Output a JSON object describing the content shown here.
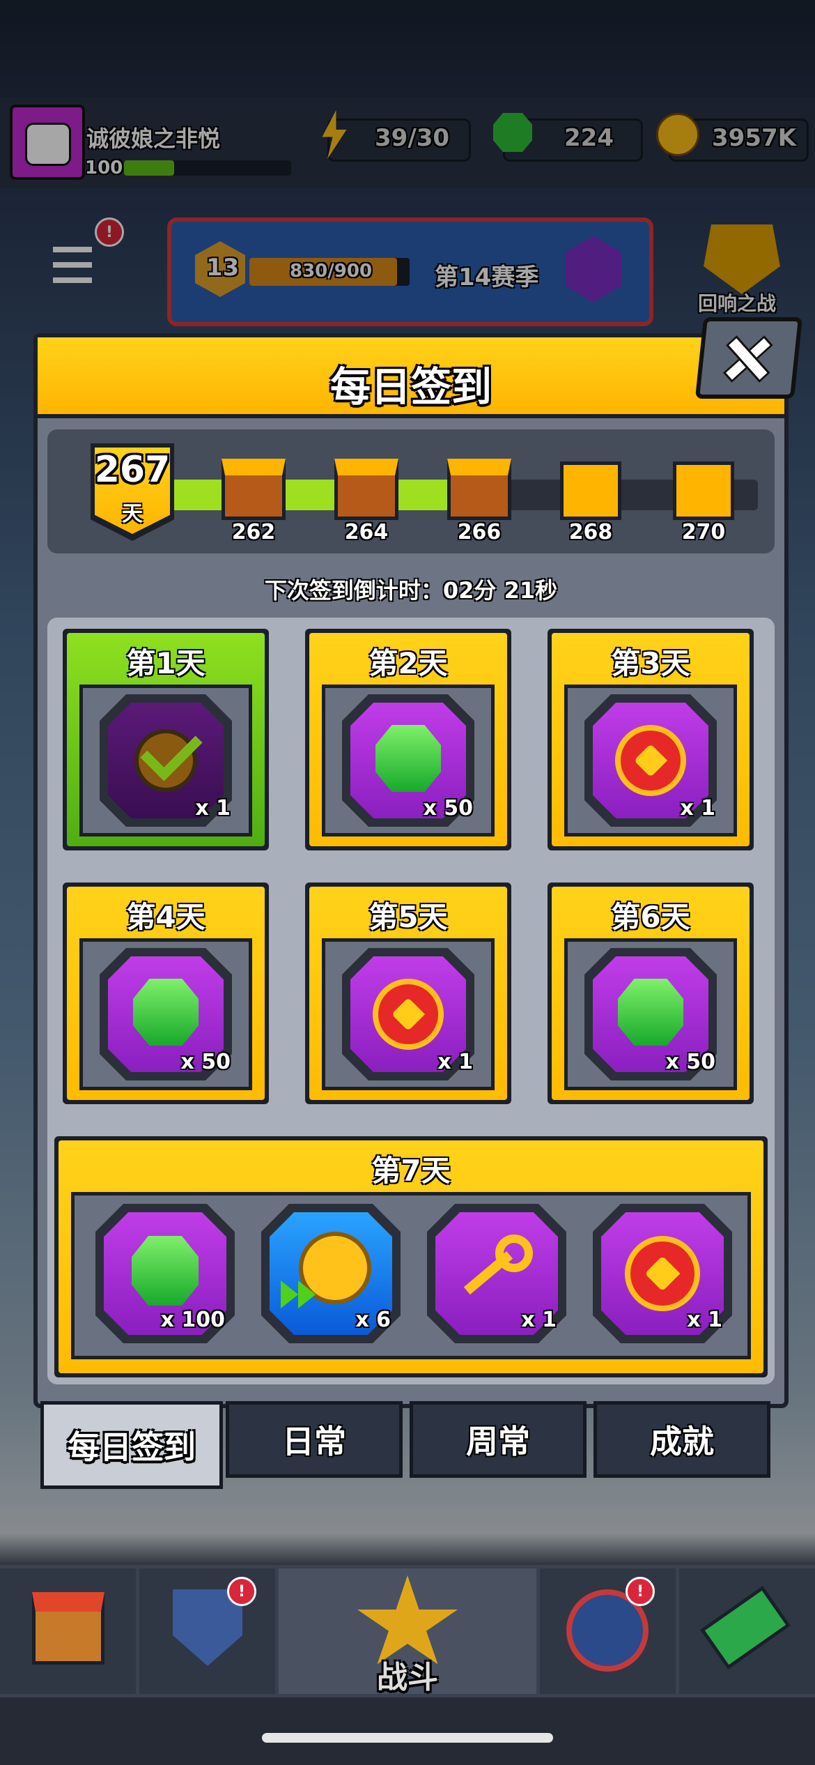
{
  "player": {
    "name": "诚彼娘之非悦",
    "level": "100"
  },
  "resources": {
    "energy": "39/30",
    "gems": "224",
    "coins": "3957K"
  },
  "season": {
    "level": "13",
    "progress": "830/900",
    "label": "第14赛季"
  },
  "event": {
    "label": "回响之战"
  },
  "modal": {
    "title": "每日签到",
    "streak_days": "267",
    "streak_unit": "天",
    "milestones": [
      {
        "day": "262",
        "opened": true
      },
      {
        "day": "264",
        "opened": true
      },
      {
        "day": "266",
        "opened": true
      },
      {
        "day": "268",
        "opened": false
      },
      {
        "day": "270",
        "opened": false
      }
    ],
    "countdown": "下次签到倒计时：02分 21秒",
    "days": [
      {
        "title": "第1天",
        "item": "checked-reward-icon",
        "qty": "x 1",
        "claimed": true
      },
      {
        "title": "第2天",
        "item": "gem-icon",
        "qty": "x 50",
        "claimed": false
      },
      {
        "title": "第3天",
        "item": "heart-coin-icon",
        "qty": "x 1",
        "claimed": false
      },
      {
        "title": "第4天",
        "item": "gem-icon",
        "qty": "x 50",
        "claimed": false
      },
      {
        "title": "第5天",
        "item": "heart-coin-icon",
        "qty": "x 1",
        "claimed": false
      },
      {
        "title": "第6天",
        "item": "gem-icon",
        "qty": "x 50",
        "claimed": false
      }
    ],
    "day7": {
      "title": "第7天",
      "items": [
        {
          "item": "gem-icon",
          "qty": "x 100"
        },
        {
          "item": "speed-coin-icon",
          "qty": "x 6"
        },
        {
          "item": "key-icon",
          "qty": "x 1"
        },
        {
          "item": "heart-coin-icon",
          "qty": "x 1"
        }
      ]
    }
  },
  "tabs": [
    "每日签到",
    "日常",
    "周常",
    "成就"
  ],
  "bottom_nav": {
    "battle_label": "战斗"
  },
  "colors": {
    "gold": "#ffc000",
    "green": "#6fcf17",
    "purple": "#a52fd6",
    "dark": "#1a1f2a"
  }
}
